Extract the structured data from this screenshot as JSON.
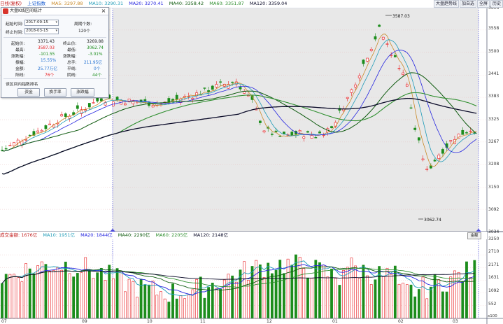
{
  "kline_header": {
    "title": "日线(复权)",
    "index": "上证指数",
    "ma5": "MA5: 3297.88",
    "ma10": "MA10: 3290.31",
    "ma20": "MA20: 3270.41",
    "ma40": "MA40: 3358.42",
    "ma60": "MA60: 3351.87",
    "ma120": "MA120: 3359.04"
  },
  "toolbar": {
    "btn1": "大盘趋势线",
    "btn2": "加自选",
    "btn3": "全屏",
    "btn4": "历史"
  },
  "volume_header": {
    "label": "成交金额: 1676亿",
    "ma10": "MA10: 1951亿",
    "ma20": "MA20: 1844亿",
    "ma40": "MA40: 2290亿",
    "ma60": "MA60: 2205亿",
    "ma120": "MA120: 2148亿",
    "switch": "金额"
  },
  "price_axis": [
    "3616",
    "3558",
    "3500",
    "3441",
    "3383",
    "3325",
    "3267",
    "3208",
    "3150",
    "3092",
    "3034"
  ],
  "volume_axis": [
    "3250",
    "2710",
    "2171",
    "1631",
    "1092",
    "552",
    "x100"
  ],
  "date_axis": [
    "07",
    "09",
    "10",
    "11",
    "12",
    "01",
    "02",
    "03"
  ],
  "annotations": {
    "high": "3587.03",
    "low": "3062.74"
  },
  "dialog": {
    "title": "大盘K线区间统计",
    "start_label": "起始时间:",
    "start_value": "2017-09-15",
    "end_label": "终止时间:",
    "end_value": "2018-03-15",
    "periods_label": "周期个数:",
    "periods_value": "120个",
    "rows": [
      {
        "l1": "起始价:",
        "v1": "3371.43",
        "l2": "终止价:",
        "v2": "3269.88"
      },
      {
        "l1": "最高:",
        "v1": "3587.03",
        "l2": "最低:",
        "v2": "3062.74"
      },
      {
        "l1": "涨跌幅:",
        "v1": "-101.55",
        "l2": "涨跌幅:",
        "v2": "-3.01%"
      },
      {
        "l1": "振幅:",
        "v1": "15.55%",
        "l2": "总手:",
        "v2": "211.95亿"
      },
      {
        "l1": "金额:",
        "v1": "25.77万亿",
        "l2": "平线:",
        "v2": "0个"
      },
      {
        "l1": "阳线:",
        "v1": "76个",
        "l2": "阴线:",
        "v2": "44个"
      }
    ],
    "section": "该区间内指数排名",
    "btn_fund": "资金",
    "btn_turnover": "换手率",
    "btn_change": "涨跌幅"
  },
  "colors": {
    "up": "#e8191d",
    "down": "#1c8d1c",
    "ma5": "#c98a2a",
    "ma10": "#1f9bb8",
    "ma20": "#2424e0",
    "ma40": "#0e5a0e",
    "ma60": "#2f8f2f",
    "ma120": "#0a0a28"
  }
}
